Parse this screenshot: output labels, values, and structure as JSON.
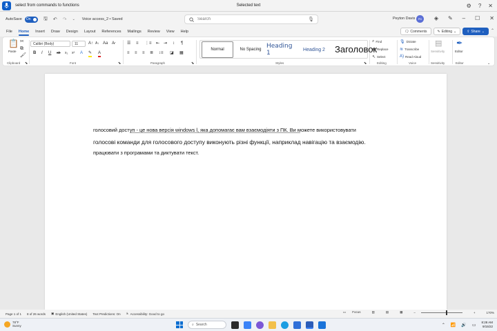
{
  "voice_access": {
    "command_text": "select from commands to functions",
    "status_text": "Selected text"
  },
  "titlebar": {
    "autosave_label": "AutoSave",
    "toggle_state": "On",
    "document_name": "Voice access_2 • Saved",
    "search_placeholder": "Search",
    "user_name": "Peyton Davis",
    "user_initials": "PD"
  },
  "tabs": [
    "File",
    "Home",
    "Insert",
    "Draw",
    "Design",
    "Layout",
    "References",
    "Mailings",
    "Review",
    "View",
    "Help"
  ],
  "tab_actions": {
    "comments": "Comments",
    "editing": "Editing",
    "share": "Share"
  },
  "ribbon": {
    "paste_label": "Paste",
    "font_name": "Calibri (Body)",
    "font_size": "11",
    "styles": [
      "Normal",
      "No Spacing",
      "Heading 1",
      "Heading 2"
    ],
    "find": "Find",
    "replace": "Replace",
    "select": "Select",
    "dictate": "Dictate",
    "transcribe": "Transcribe",
    "read_aloud": "Read Aloud",
    "sensitivity": "Sensitivity",
    "editor": "Editor",
    "groups": {
      "clipboard": "Clipboard",
      "font": "Font",
      "paragraph": "Paragraph",
      "styles": "Styles",
      "editing": "Editing",
      "voice": "Voice",
      "sensitivity": "Sensitivity",
      "editor": "Editor"
    },
    "hover_tooltip": "Заголовок"
  },
  "document": {
    "line1": "голосовий доступ - це нова версія windows l, яка допомагає вам взаємодіяти з ПК. Ви можете використовувати",
    "line2": "голосові команди для голосового доступу виконують різні функції, наприклад навігацію та взаємодію.",
    "line3": "працювати з програмами та диктувати текст."
  },
  "statusbar": {
    "page": "Page 1 of 1",
    "words": "8 of 26 words",
    "language": "English (United States)",
    "predictions": "Text Predictions: On",
    "accessibility": "Accessibility: Good to go",
    "focus": "Focus",
    "zoom": "170%"
  },
  "taskbar": {
    "temperature": "78°F",
    "weather": "Sunny",
    "search": "Search",
    "time": "8:28 AM",
    "date": "9/15/22"
  },
  "colors": {
    "accent": "#1f5fbf",
    "heading": "#2f5496",
    "voice_access_icon": "#0f5ec9"
  }
}
